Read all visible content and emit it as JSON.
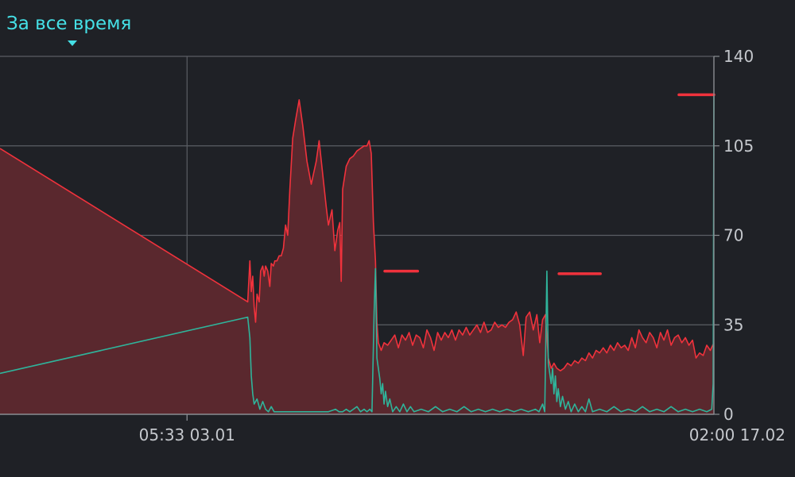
{
  "header": {
    "range_label": "За все время"
  },
  "colors": {
    "background": "#1f2126",
    "grid": "#5b5e64",
    "axis": "#8a8d92",
    "accent": "#45e0e6",
    "series_red": "#f0323c",
    "series_red_fill": "#5a282e",
    "series_teal": "#2fb49b",
    "tick_text": "#c4c7cc"
  },
  "chart_data": {
    "type": "area",
    "y_ticks": [
      "140",
      "105",
      "70",
      "35",
      "0"
    ],
    "ylim": [
      0,
      140
    ],
    "x_ticks": [
      "05:33 03.01",
      "02:00 17.02"
    ],
    "grid": true,
    "series": [
      {
        "color": "#f0323c",
        "fill": "#5a282e",
        "points": [
          [
            0.0,
            104
          ],
          [
            0.347,
            44
          ],
          [
            0.35,
            60
          ],
          [
            0.352,
            48
          ],
          [
            0.354,
            54
          ],
          [
            0.356,
            42
          ],
          [
            0.358,
            36
          ],
          [
            0.36,
            47
          ],
          [
            0.363,
            44
          ],
          [
            0.365,
            56
          ],
          [
            0.368,
            58
          ],
          [
            0.37,
            54
          ],
          [
            0.372,
            58
          ],
          [
            0.375,
            56
          ],
          [
            0.378,
            50
          ],
          [
            0.38,
            59
          ],
          [
            0.383,
            58
          ],
          [
            0.385,
            60
          ],
          [
            0.388,
            60
          ],
          [
            0.391,
            62
          ],
          [
            0.394,
            62
          ],
          [
            0.397,
            65
          ],
          [
            0.4,
            74
          ],
          [
            0.403,
            70
          ],
          [
            0.406,
            88
          ],
          [
            0.41,
            108
          ],
          [
            0.414,
            115
          ],
          [
            0.419,
            123
          ],
          [
            0.424,
            113
          ],
          [
            0.43,
            99
          ],
          [
            0.436,
            90
          ],
          [
            0.443,
            99
          ],
          [
            0.447,
            107
          ],
          [
            0.452,
            94
          ],
          [
            0.457,
            81
          ],
          [
            0.46,
            74
          ],
          [
            0.465,
            80
          ],
          [
            0.469,
            64
          ],
          [
            0.473,
            72
          ],
          [
            0.476,
            75
          ],
          [
            0.478,
            52
          ],
          [
            0.48,
            88
          ],
          [
            0.485,
            97
          ],
          [
            0.49,
            100
          ],
          [
            0.495,
            101
          ],
          [
            0.5,
            103
          ],
          [
            0.505,
            104
          ],
          [
            0.51,
            105
          ],
          [
            0.514,
            105
          ],
          [
            0.517,
            107
          ],
          [
            0.52,
            102
          ],
          [
            0.523,
            75
          ],
          [
            0.526,
            60
          ],
          [
            0.528,
            36
          ],
          [
            0.53,
            28
          ],
          [
            0.534,
            25
          ],
          [
            0.538,
            28
          ],
          [
            0.543,
            27
          ],
          [
            0.548,
            29
          ],
          [
            0.553,
            31
          ],
          [
            0.558,
            26
          ],
          [
            0.563,
            31
          ],
          [
            0.568,
            29
          ],
          [
            0.573,
            32
          ],
          [
            0.578,
            27
          ],
          [
            0.583,
            31
          ],
          [
            0.588,
            30
          ],
          [
            0.593,
            26
          ],
          [
            0.598,
            33
          ],
          [
            0.603,
            30
          ],
          [
            0.608,
            25
          ],
          [
            0.613,
            32
          ],
          [
            0.618,
            29
          ],
          [
            0.623,
            32
          ],
          [
            0.628,
            30
          ],
          [
            0.633,
            33
          ],
          [
            0.638,
            29
          ],
          [
            0.643,
            33
          ],
          [
            0.648,
            31
          ],
          [
            0.653,
            34
          ],
          [
            0.658,
            31
          ],
          [
            0.663,
            33
          ],
          [
            0.668,
            35
          ],
          [
            0.673,
            32
          ],
          [
            0.678,
            36
          ],
          [
            0.683,
            32
          ],
          [
            0.688,
            33
          ],
          [
            0.693,
            36
          ],
          [
            0.698,
            34
          ],
          [
            0.703,
            35
          ],
          [
            0.708,
            34
          ],
          [
            0.713,
            36
          ],
          [
            0.718,
            37
          ],
          [
            0.723,
            40
          ],
          [
            0.728,
            35
          ],
          [
            0.733,
            23
          ],
          [
            0.737,
            38
          ],
          [
            0.742,
            40
          ],
          [
            0.747,
            33
          ],
          [
            0.752,
            39
          ],
          [
            0.756,
            28
          ],
          [
            0.76,
            37
          ],
          [
            0.764,
            39
          ],
          [
            0.768,
            22
          ],
          [
            0.772,
            18
          ],
          [
            0.776,
            20
          ],
          [
            0.78,
            18
          ],
          [
            0.785,
            17
          ],
          [
            0.79,
            18
          ],
          [
            0.795,
            20
          ],
          [
            0.8,
            19
          ],
          [
            0.805,
            21
          ],
          [
            0.81,
            20
          ],
          [
            0.815,
            22
          ],
          [
            0.82,
            21
          ],
          [
            0.825,
            24
          ],
          [
            0.83,
            22
          ],
          [
            0.835,
            25
          ],
          [
            0.84,
            24
          ],
          [
            0.845,
            26
          ],
          [
            0.85,
            24
          ],
          [
            0.855,
            27
          ],
          [
            0.86,
            25
          ],
          [
            0.865,
            28
          ],
          [
            0.87,
            26
          ],
          [
            0.875,
            27
          ],
          [
            0.88,
            25
          ],
          [
            0.885,
            30
          ],
          [
            0.89,
            26
          ],
          [
            0.895,
            33
          ],
          [
            0.9,
            30
          ],
          [
            0.905,
            28
          ],
          [
            0.91,
            32
          ],
          [
            0.915,
            30
          ],
          [
            0.92,
            26
          ],
          [
            0.925,
            32
          ],
          [
            0.93,
            29
          ],
          [
            0.935,
            33
          ],
          [
            0.94,
            27
          ],
          [
            0.945,
            30
          ],
          [
            0.95,
            31
          ],
          [
            0.955,
            28
          ],
          [
            0.96,
            30
          ],
          [
            0.965,
            27
          ],
          [
            0.97,
            29
          ],
          [
            0.975,
            22
          ],
          [
            0.98,
            24
          ],
          [
            0.985,
            23
          ],
          [
            0.99,
            27
          ],
          [
            0.995,
            25
          ],
          [
            1.0,
            28
          ]
        ]
      },
      {
        "color": "#2fb49b",
        "points": [
          [
            0.0,
            16
          ],
          [
            0.347,
            38
          ],
          [
            0.35,
            30
          ],
          [
            0.352,
            15
          ],
          [
            0.354,
            8
          ],
          [
            0.356,
            4
          ],
          [
            0.36,
            6
          ],
          [
            0.364,
            2
          ],
          [
            0.368,
            5
          ],
          [
            0.372,
            2
          ],
          [
            0.376,
            1
          ],
          [
            0.38,
            3
          ],
          [
            0.384,
            1
          ],
          [
            0.39,
            1
          ],
          [
            0.4,
            1
          ],
          [
            0.41,
            1
          ],
          [
            0.42,
            1
          ],
          [
            0.43,
            1
          ],
          [
            0.44,
            1
          ],
          [
            0.45,
            1
          ],
          [
            0.46,
            1
          ],
          [
            0.47,
            2
          ],
          [
            0.475,
            1
          ],
          [
            0.48,
            1
          ],
          [
            0.485,
            2
          ],
          [
            0.49,
            1
          ],
          [
            0.495,
            2
          ],
          [
            0.5,
            3
          ],
          [
            0.505,
            1
          ],
          [
            0.51,
            2
          ],
          [
            0.514,
            1
          ],
          [
            0.518,
            2
          ],
          [
            0.521,
            1
          ],
          [
            0.524,
            40
          ],
          [
            0.526,
            57
          ],
          [
            0.528,
            22
          ],
          [
            0.53,
            18
          ],
          [
            0.532,
            14
          ],
          [
            0.534,
            8
          ],
          [
            0.536,
            12
          ],
          [
            0.538,
            4
          ],
          [
            0.54,
            9
          ],
          [
            0.543,
            3
          ],
          [
            0.546,
            6
          ],
          [
            0.55,
            1
          ],
          [
            0.555,
            3
          ],
          [
            0.56,
            1
          ],
          [
            0.565,
            4
          ],
          [
            0.57,
            1
          ],
          [
            0.575,
            3
          ],
          [
            0.58,
            1
          ],
          [
            0.59,
            2
          ],
          [
            0.6,
            1
          ],
          [
            0.61,
            3
          ],
          [
            0.62,
            1
          ],
          [
            0.63,
            2
          ],
          [
            0.64,
            1
          ],
          [
            0.65,
            3
          ],
          [
            0.66,
            1
          ],
          [
            0.67,
            2
          ],
          [
            0.68,
            1
          ],
          [
            0.69,
            2
          ],
          [
            0.7,
            1
          ],
          [
            0.71,
            2
          ],
          [
            0.72,
            1
          ],
          [
            0.73,
            2
          ],
          [
            0.74,
            1
          ],
          [
            0.75,
            2
          ],
          [
            0.755,
            1
          ],
          [
            0.76,
            4
          ],
          [
            0.763,
            1
          ],
          [
            0.766,
            56
          ],
          [
            0.768,
            20
          ],
          [
            0.77,
            16
          ],
          [
            0.772,
            12
          ],
          [
            0.774,
            18
          ],
          [
            0.776,
            8
          ],
          [
            0.778,
            15
          ],
          [
            0.78,
            5
          ],
          [
            0.782,
            10
          ],
          [
            0.785,
            3
          ],
          [
            0.788,
            7
          ],
          [
            0.792,
            2
          ],
          [
            0.796,
            5
          ],
          [
            0.8,
            1
          ],
          [
            0.805,
            4
          ],
          [
            0.81,
            1
          ],
          [
            0.815,
            3
          ],
          [
            0.82,
            1
          ],
          [
            0.825,
            6
          ],
          [
            0.83,
            1
          ],
          [
            0.84,
            2
          ],
          [
            0.85,
            1
          ],
          [
            0.86,
            3
          ],
          [
            0.87,
            1
          ],
          [
            0.88,
            2
          ],
          [
            0.89,
            1
          ],
          [
            0.9,
            3
          ],
          [
            0.91,
            1
          ],
          [
            0.92,
            2
          ],
          [
            0.93,
            1
          ],
          [
            0.94,
            3
          ],
          [
            0.95,
            1
          ],
          [
            0.96,
            2
          ],
          [
            0.97,
            1
          ],
          [
            0.98,
            2
          ],
          [
            0.99,
            1
          ],
          [
            0.997,
            2
          ],
          [
            0.999,
            12
          ],
          [
            1.0,
            125
          ]
        ]
      }
    ],
    "markers": [
      {
        "x0": 0.539,
        "x1": 0.585,
        "y": 56
      },
      {
        "x0": 0.783,
        "x1": 0.841,
        "y": 55
      },
      {
        "x0": 0.951,
        "x1": 1.0,
        "y": 125
      }
    ]
  }
}
